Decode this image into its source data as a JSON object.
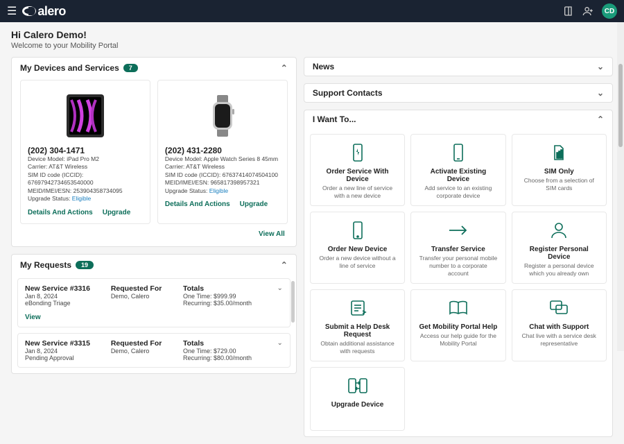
{
  "topbar": {
    "logo_text": "alero",
    "avatar": "CD"
  },
  "greeting": {
    "title": "Hi Calero Demo!",
    "subtitle": "Welcome to your Mobility Portal"
  },
  "devices": {
    "header": "My Devices and Services",
    "count": "7",
    "view_all": "View All",
    "cards": [
      {
        "phone": "(202) 304-1471",
        "model": "Device Model: iPad Pro M2",
        "carrier": "Carrier: AT&T Wireless",
        "sim": "SIM ID code (ICCID): 67697942734653540000",
        "imei": "MEID/IMEI/ESN: 253904358734095",
        "status_label": "Upgrade Status: ",
        "status_value": "Eligible",
        "action_details": "Details And Actions",
        "action_upgrade": "Upgrade"
      },
      {
        "phone": "(202) 431-2280",
        "model": "Device Model: Apple Watch Series 8 45mm",
        "carrier": "Carrier: AT&T Wireless",
        "sim": "SIM ID code (ICCID): 67637414074504100",
        "imei": "MEID/IMEI/ESN: 965817398957321",
        "status_label": "Upgrade Status: ",
        "status_value": "Eligible",
        "action_details": "Details And Actions",
        "action_upgrade": "Upgrade"
      }
    ]
  },
  "requests": {
    "header": "My Requests",
    "count": "19",
    "view": "View",
    "items": [
      {
        "title": "New Service #3316",
        "date": "Jan 8, 2024",
        "status": "eBonding Triage",
        "req_for_label": "Requested For",
        "req_for": "Demo, Calero",
        "totals_label": "Totals",
        "onetime": "One Time: $999.99",
        "recurring": "Recurring: $35.00/month"
      },
      {
        "title": "New Service #3315",
        "date": "Jan 8, 2024",
        "status": "Pending Approval",
        "req_for_label": "Requested For",
        "req_for": "Demo, Calero",
        "totals_label": "Totals",
        "onetime": "One Time: $729.00",
        "recurring": "Recurring: $80.00/month"
      }
    ]
  },
  "right": {
    "news": "News",
    "contacts": "Support Contacts",
    "iwant": "I Want To...",
    "tiles": [
      {
        "title": "Order Service With Device",
        "desc": "Order a new line of service with a new device"
      },
      {
        "title": "Activate Existing Device",
        "desc": "Add service to an existing corporate device"
      },
      {
        "title": "SIM Only",
        "desc": "Choose from a selection of SIM cards"
      },
      {
        "title": "Order New Device",
        "desc": "Order a new device without a line of service"
      },
      {
        "title": "Transfer Service",
        "desc": "Transfer your personal mobile number to a corporate account"
      },
      {
        "title": "Register Personal Device",
        "desc": "Register a personal device which you already own"
      },
      {
        "title": "Submit a Help Desk Request",
        "desc": "Obtain additional assistance with requests"
      },
      {
        "title": "Get Mobility Portal Help",
        "desc": "Access our help guide for the Mobility Portal"
      },
      {
        "title": "Chat with Support",
        "desc": "Chat live with a service desk representative"
      },
      {
        "title": "Upgrade Device",
        "desc": ""
      }
    ]
  }
}
